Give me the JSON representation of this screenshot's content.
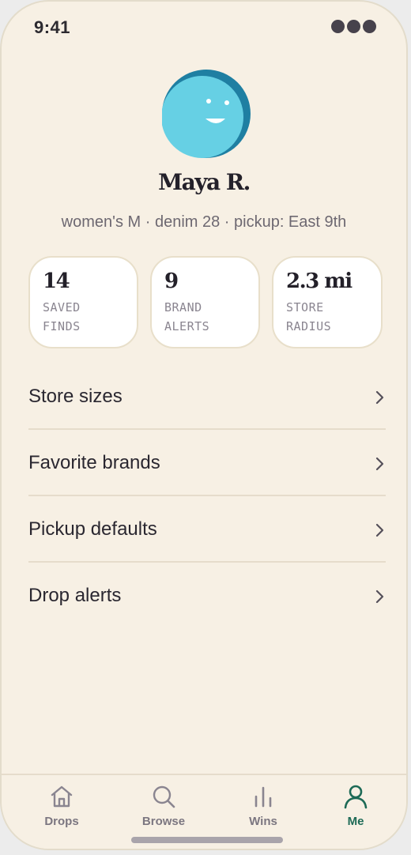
{
  "status_bar": {
    "time": "9:41"
  },
  "profile": {
    "name": "Maya R.",
    "meta": "women's M · denim 28 · pickup: East 9th",
    "avatar_icon": "smiley-face-avatar",
    "avatar_color": "#66d0e4",
    "avatar_ring_color": "#1f7fa2"
  },
  "stats": [
    {
      "value": "14",
      "label": "SAVED FINDS"
    },
    {
      "value": "9",
      "label": "BRAND ALERTS"
    },
    {
      "value": "2.3 mi",
      "label": "STORE RADIUS"
    }
  ],
  "menu": [
    {
      "label": "Store sizes",
      "icon": "chevron-right-icon"
    },
    {
      "label": "Favorite brands",
      "icon": "chevron-right-icon"
    },
    {
      "label": "Pickup defaults",
      "icon": "chevron-right-icon"
    },
    {
      "label": "Drop alerts",
      "icon": "chevron-right-icon"
    }
  ],
  "tabbar": {
    "tabs": [
      {
        "label": "Drops",
        "icon": "house-icon",
        "active": false
      },
      {
        "label": "Browse",
        "icon": "search-icon",
        "active": false
      },
      {
        "label": "Wins",
        "icon": "bar-chart-icon",
        "active": false
      },
      {
        "label": "Me",
        "icon": "person-icon",
        "active": true
      }
    ]
  },
  "colors": {
    "background": "#f7f0e4",
    "accent": "#1d6a56",
    "text": "#2a2730",
    "muted": "#7b7680"
  }
}
